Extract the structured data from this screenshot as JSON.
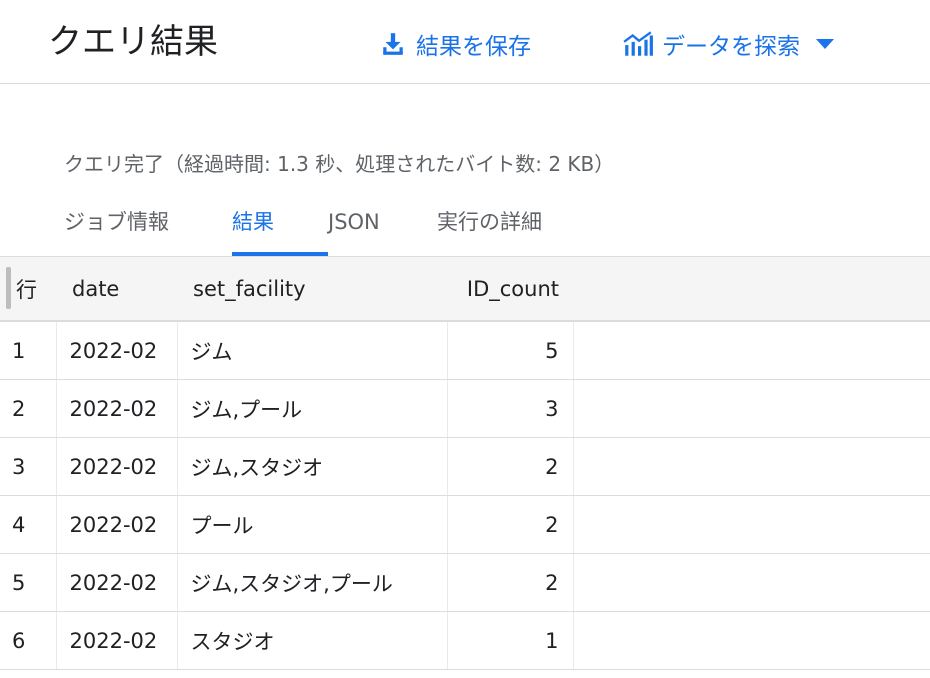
{
  "header": {
    "title": "クエリ結果",
    "save_label": "結果を保存",
    "explore_label": "データを探索"
  },
  "status": "クエリ完了（経過時間: 1.3 秒、処理されたバイト数: 2 KB）",
  "tabs": [
    {
      "label": "ジョブ情報",
      "active": false
    },
    {
      "label": "結果",
      "active": true
    },
    {
      "label": "JSON",
      "active": false
    },
    {
      "label": "実行の詳細",
      "active": false
    }
  ],
  "table": {
    "columns": [
      "行",
      "date",
      "set_facility",
      "ID_count"
    ],
    "rows": [
      [
        "1",
        "2022-02",
        "ジム",
        "5"
      ],
      [
        "2",
        "2022-02",
        "ジム,プール",
        "3"
      ],
      [
        "3",
        "2022-02",
        "ジム,スタジオ",
        "2"
      ],
      [
        "4",
        "2022-02",
        "プール",
        "2"
      ],
      [
        "5",
        "2022-02",
        "ジム,スタジオ,プール",
        "2"
      ],
      [
        "6",
        "2022-02",
        "スタジオ",
        "1"
      ]
    ]
  },
  "colors": {
    "accent": "#1a73e8",
    "text": "#202124",
    "muted": "#5f6368",
    "divider": "#dadce0",
    "header_bg": "#f5f5f5"
  },
  "icons": {
    "save": "download-icon",
    "explore": "chart-explore-icon",
    "caret": "caret-down-icon"
  }
}
